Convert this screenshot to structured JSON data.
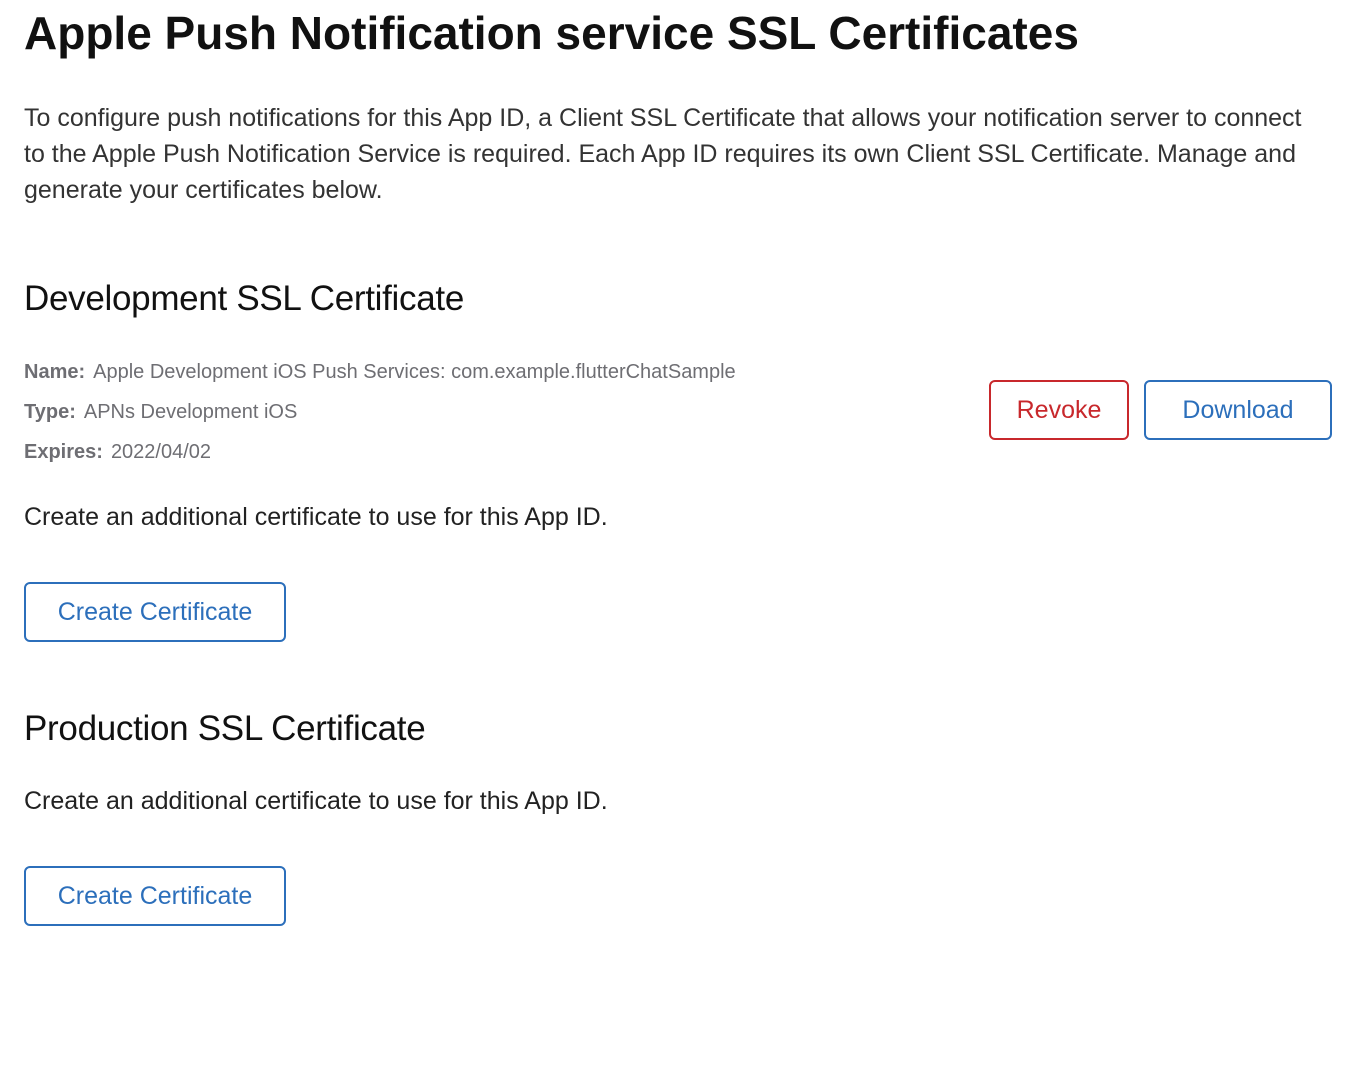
{
  "page": {
    "title": "Apple Push Notification service SSL Certificates",
    "intro": "To configure push notifications for this App ID, a Client SSL Certificate that allows your notification server to connect to the Apple Push Notification Service is required. Each App ID requires its own Client SSL Certificate. Manage and generate your certificates below."
  },
  "development": {
    "title": "Development SSL Certificate",
    "details": {
      "name_label": "Name:",
      "name_value": "Apple Development iOS Push Services: com.example.flutterChatSample",
      "type_label": "Type:",
      "type_value": "APNs Development iOS",
      "expires_label": "Expires:",
      "expires_value": "2022/04/02"
    },
    "revoke_label": "Revoke",
    "download_label": "Download",
    "create_text": "Create an additional certificate to use for this App ID.",
    "create_button_label": "Create Certificate"
  },
  "production": {
    "title": "Production SSL Certificate",
    "create_text": "Create an additional certificate to use for this App ID.",
    "create_button_label": "Create Certificate"
  },
  "colors": {
    "revoke": "#c8282c",
    "primary": "#2c6fbb",
    "title_text": "#111111",
    "detail_text": "#6e6e73"
  }
}
